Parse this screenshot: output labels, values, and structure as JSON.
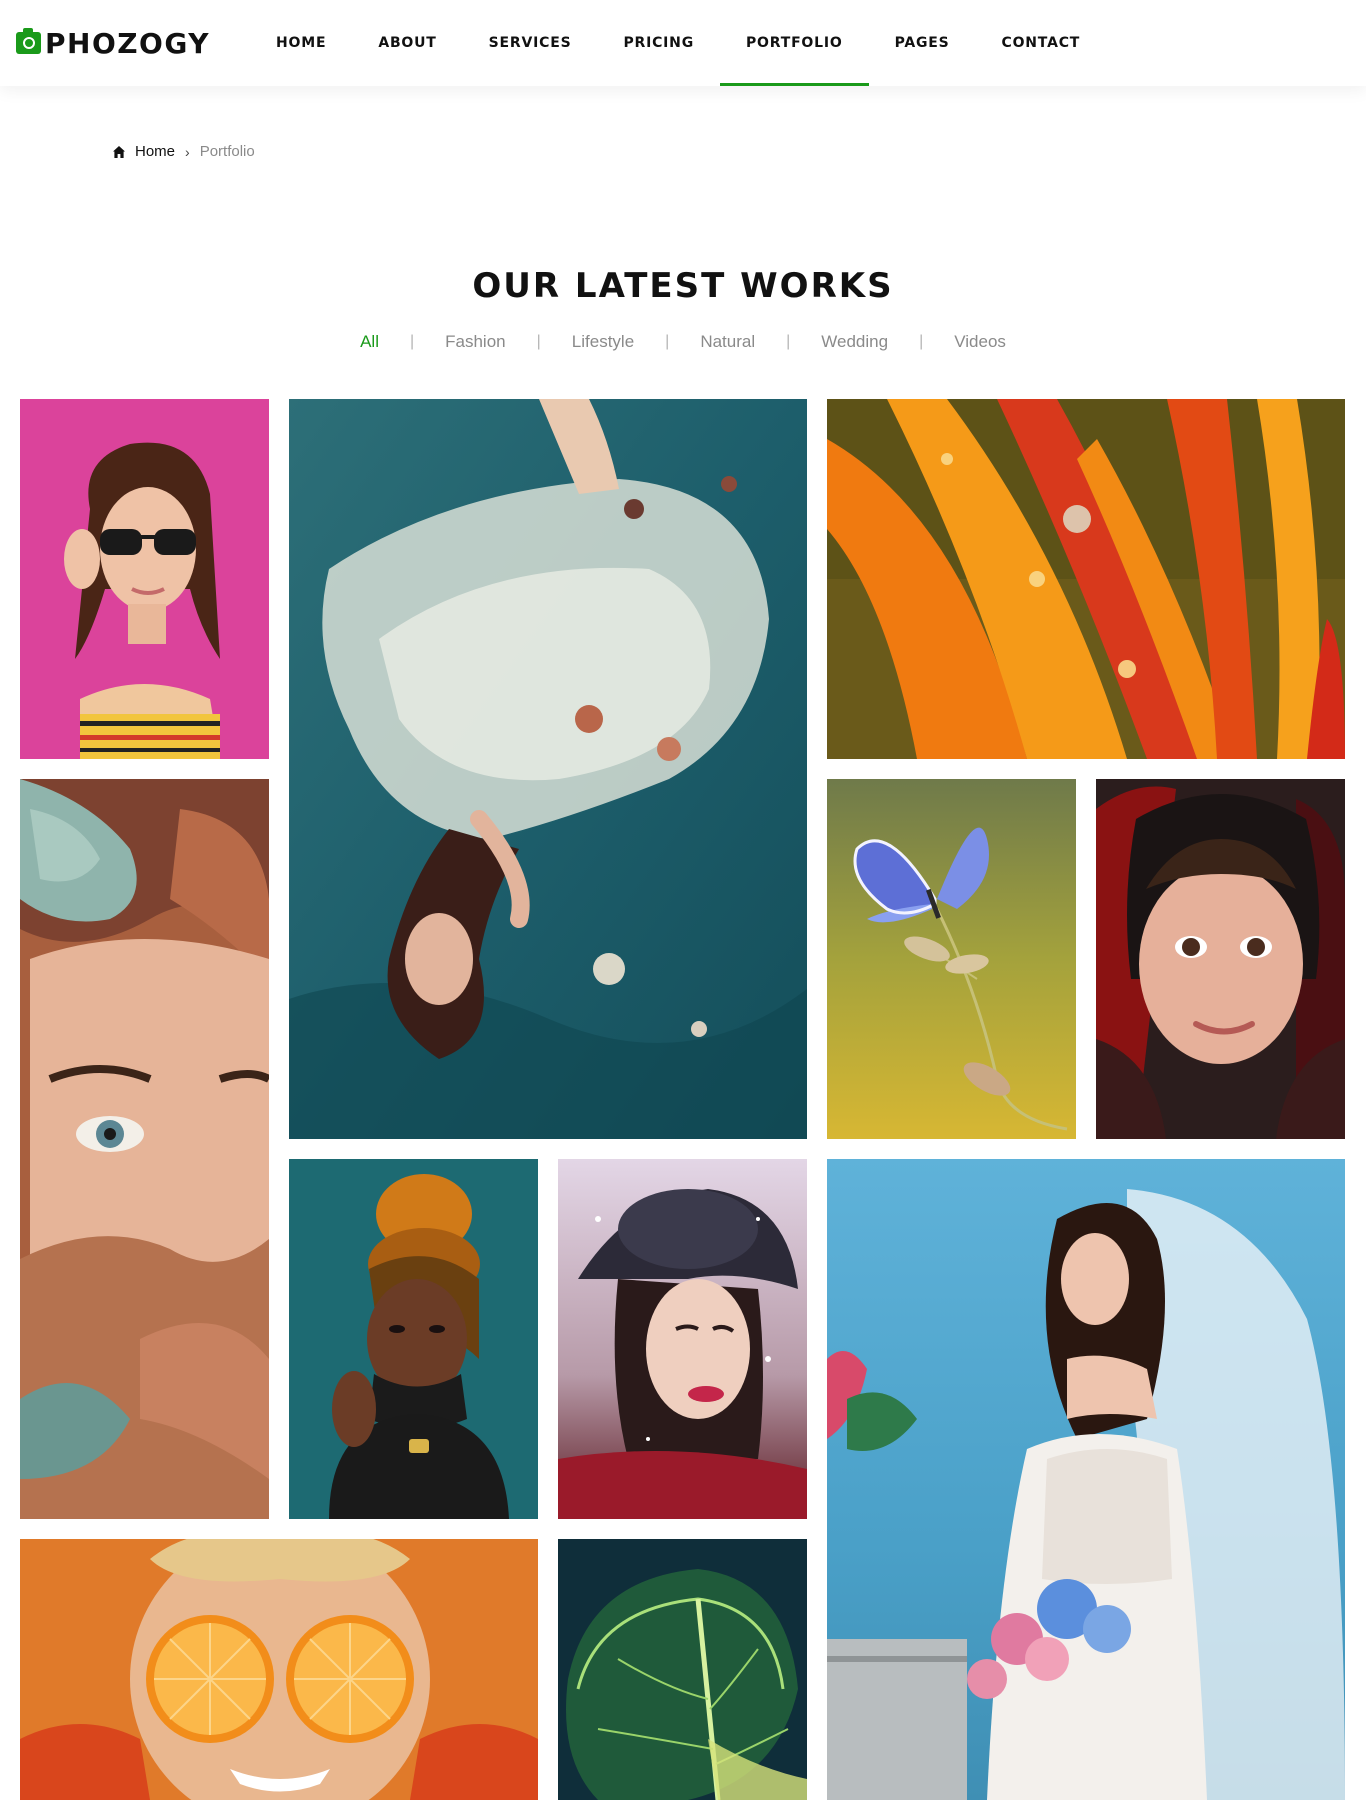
{
  "brand": {
    "name": "PHOZOGY",
    "accent": "#1a9a1a"
  },
  "nav": {
    "items": [
      {
        "label": "HOME"
      },
      {
        "label": "ABOUT"
      },
      {
        "label": "SERVICES"
      },
      {
        "label": "PRICING"
      },
      {
        "label": "PORTFOLIO",
        "active": true
      },
      {
        "label": "PAGES"
      },
      {
        "label": "CONTACT"
      }
    ]
  },
  "breadcrumb": {
    "home": "Home",
    "separator": "›",
    "current": "Portfolio"
  },
  "section": {
    "title": "OUR LATEST WORKS"
  },
  "filters": {
    "items": [
      "All",
      "Fashion",
      "Lifestyle",
      "Natural",
      "Wedding",
      "Videos"
    ],
    "active": "All",
    "separator": "|"
  },
  "gallery": {
    "items": [
      {
        "subject": "woman-sunglasses-pink-wall"
      },
      {
        "subject": "woman-floating-in-water"
      },
      {
        "subject": "orange-flower-petals-dew"
      },
      {
        "subject": "woman-eye-among-roses"
      },
      {
        "subject": "butterfly-on-grass"
      },
      {
        "subject": "girl-portrait-headscarf"
      },
      {
        "subject": "woman-braided-hair-teal"
      },
      {
        "subject": "woman-black-hat"
      },
      {
        "subject": "bride-with-bouquet"
      },
      {
        "subject": "woman-orange-halves"
      },
      {
        "subject": "green-leaf-macro"
      }
    ]
  }
}
